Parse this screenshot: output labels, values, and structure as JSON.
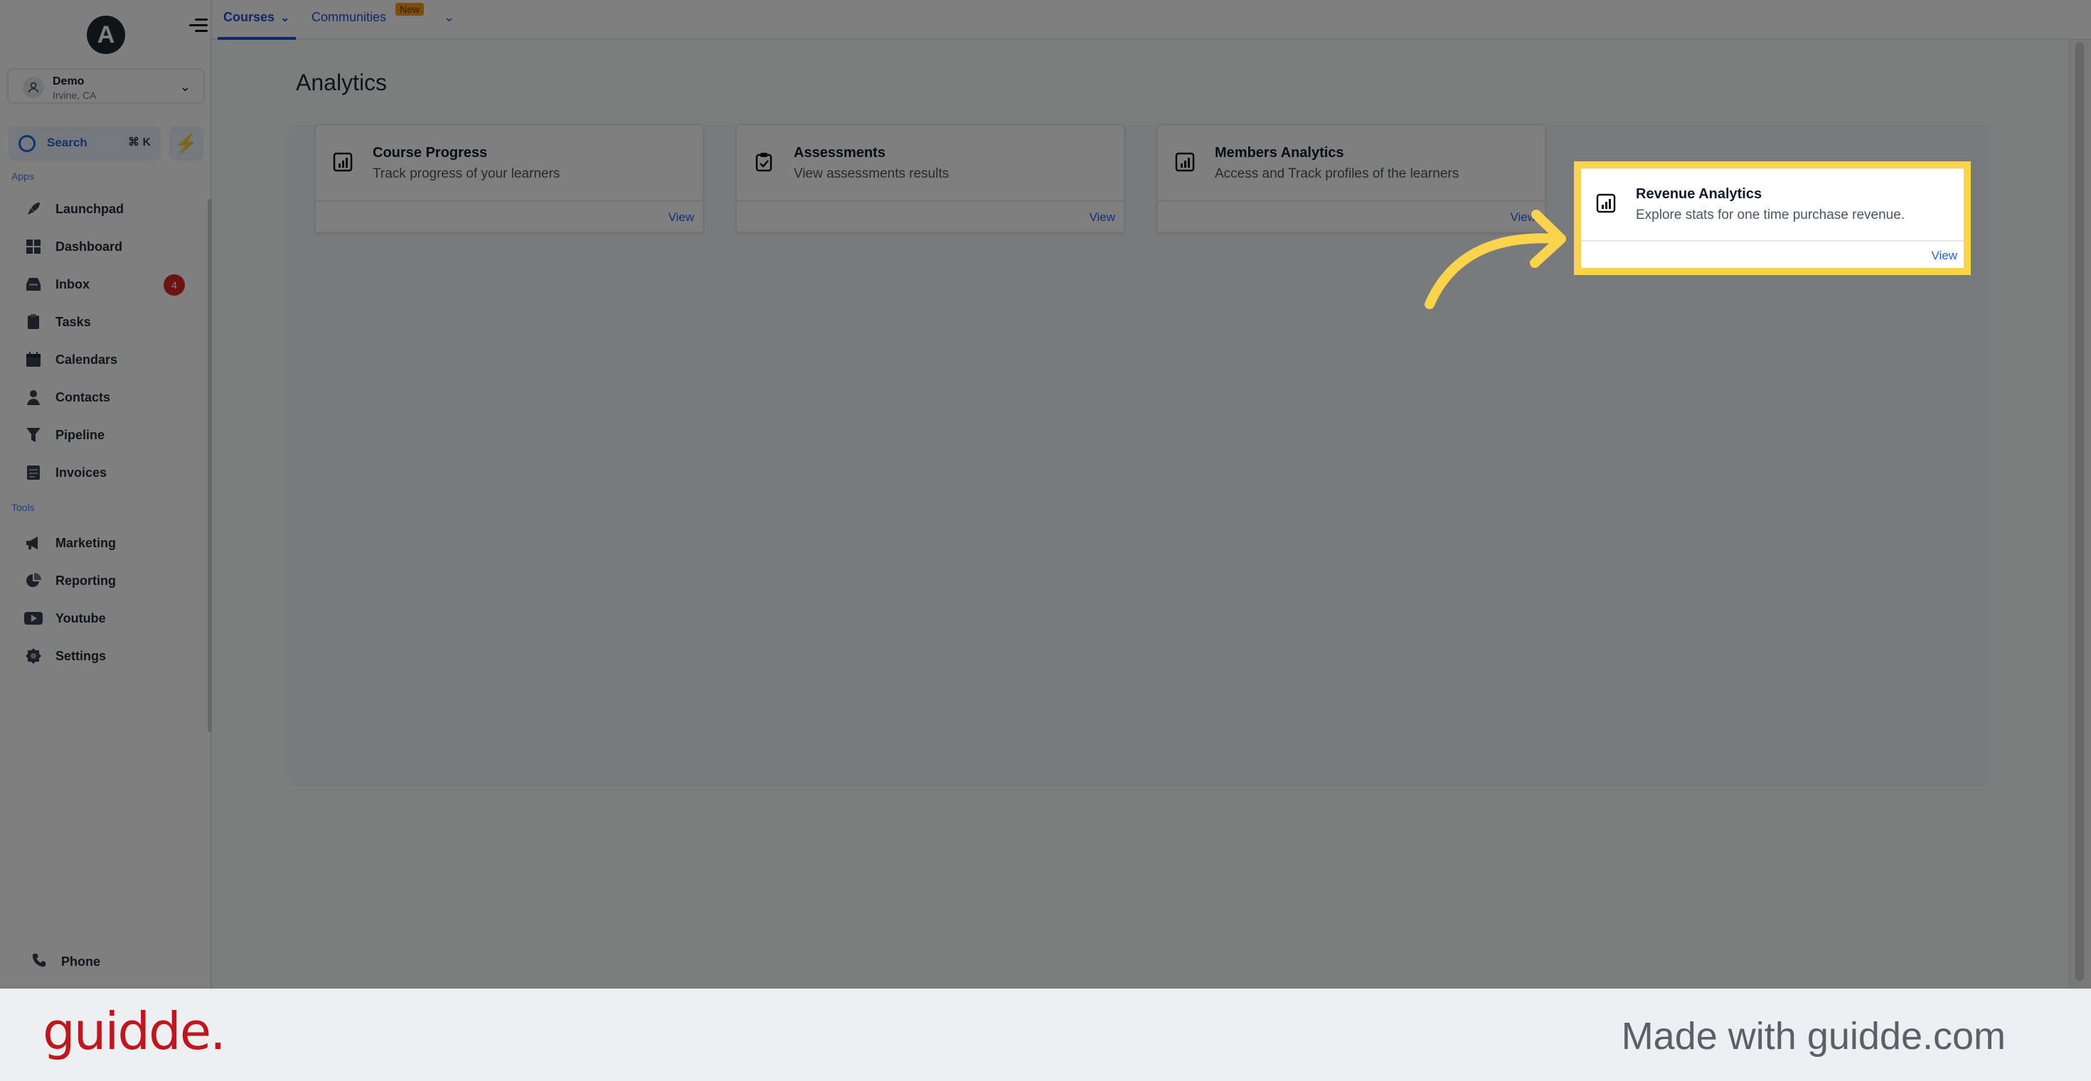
{
  "sidebar": {
    "logo_letter": "A",
    "account": {
      "name": "Demo",
      "location": "Irvine, CA"
    },
    "search": {
      "label": "Search",
      "shortcut": "⌘ K"
    },
    "apps_label": "Apps",
    "tools_label": "Tools",
    "apps": [
      {
        "label": "Launchpad",
        "icon": "rocket-icon"
      },
      {
        "label": "Dashboard",
        "icon": "dashboard-icon"
      },
      {
        "label": "Inbox",
        "icon": "inbox-icon",
        "badge": "4"
      },
      {
        "label": "Tasks",
        "icon": "tasks-icon"
      },
      {
        "label": "Calendars",
        "icon": "calendar-icon"
      },
      {
        "label": "Contacts",
        "icon": "contacts-icon"
      },
      {
        "label": "Pipeline",
        "icon": "pipeline-icon"
      },
      {
        "label": "Invoices",
        "icon": "invoice-icon"
      }
    ],
    "tools": [
      {
        "label": "Marketing",
        "icon": "megaphone-icon"
      },
      {
        "label": "Reporting",
        "icon": "pie-chart-icon"
      },
      {
        "label": "Youtube",
        "icon": "youtube-icon"
      },
      {
        "label": "Settings",
        "icon": "gear-icon"
      }
    ],
    "phone_label": "Phone"
  },
  "topnav": {
    "tabs": [
      {
        "label": "Courses",
        "active": true
      },
      {
        "label": "Communities",
        "badge": "New"
      }
    ]
  },
  "page": {
    "title": "Analytics",
    "cards": [
      {
        "title": "Course Progress",
        "description": "Track progress of your learners",
        "action": "View",
        "icon": "bar-chart-icon"
      },
      {
        "title": "Assessments",
        "description": "View assessments results",
        "action": "View",
        "icon": "clipboard-check-icon"
      },
      {
        "title": "Members Analytics",
        "description": "Access and Track profiles of the learners",
        "action": "View",
        "icon": "bar-chart-icon"
      },
      {
        "title": "Revenue Analytics",
        "description": "Explore stats for one time purchase revenue.",
        "action": "View",
        "icon": "bar-chart-icon",
        "highlighted": true
      }
    ]
  },
  "footer": {
    "brand": "guidde.",
    "made_with": "Made with guidde.com"
  },
  "colors": {
    "accent": "#2563eb",
    "highlight": "#fcd34d",
    "brand": "#c0161e",
    "badge": "#dc2626"
  }
}
